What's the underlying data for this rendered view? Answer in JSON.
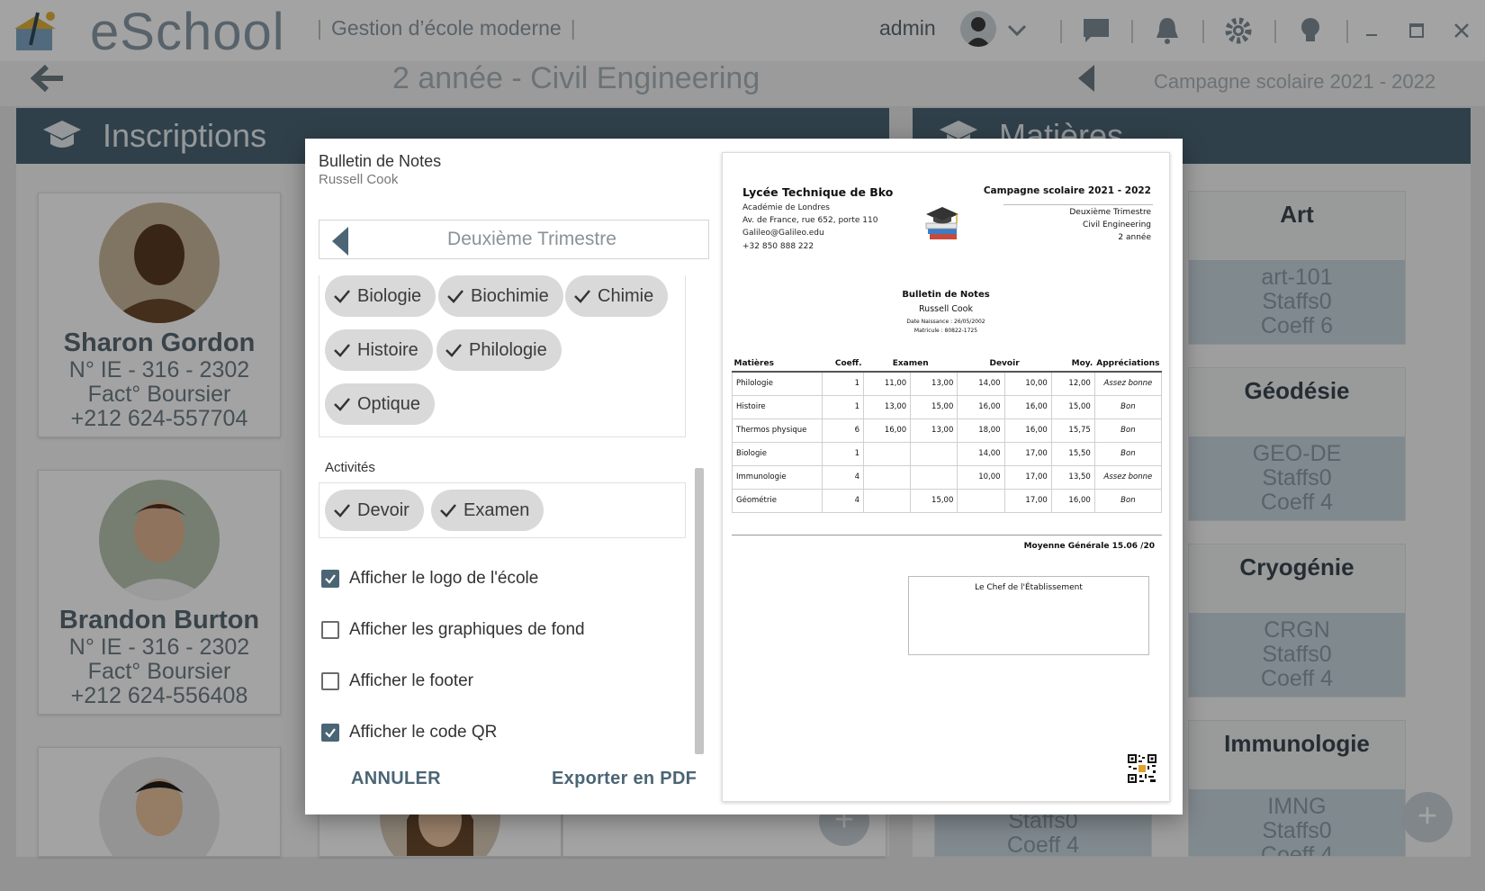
{
  "app": {
    "name": "eSchool",
    "tagline": "Gestion d’école moderne",
    "user": "admin"
  },
  "context": {
    "class_title": "2  année - Civil Engineering",
    "campaign": "Campagne scolaire 2021 - 2022"
  },
  "panels": {
    "left_title": "Inscriptions",
    "right_title": "Matières"
  },
  "students": [
    {
      "name": "Sharon Gordon",
      "id": "N° IE - 316 - 2302",
      "fact": "Fact° Boursier",
      "phone": "+212 624-557704"
    },
    {
      "name": "Brandon Burton",
      "id": "N° IE - 316 - 2302",
      "fact": "Fact° Boursier",
      "phone": "+212 624-556408"
    }
  ],
  "subjects": [
    {
      "name": "Art",
      "code": "art-101",
      "staff": "Staffs0",
      "coeff": "Coeff 6"
    },
    {
      "name": "Géodésie",
      "code": "GEO-DE",
      "staff": "Staffs0",
      "coeff": "Coeff 4"
    },
    {
      "name": "Cryogénie",
      "code": "CRGN",
      "staff": "Staffs0",
      "coeff": "Coeff 4"
    },
    {
      "name": "Immunologie",
      "code": "IMNG",
      "staff": "Staffs0",
      "coeff": "Coeff 4"
    }
  ],
  "hidden_card": {
    "staff": "Staffs0",
    "coeff": "Coeff 4"
  },
  "modal": {
    "title": "Bulletin de Notes",
    "student": "Russell Cook",
    "term": "Deuxième Trimestre",
    "subject_chips": [
      "Biologie",
      "Biochimie",
      "Chimie",
      "Histoire",
      "Philologie",
      "Optique"
    ],
    "activities_label": "Activités",
    "activity_chips": [
      "Devoir",
      "Examen"
    ],
    "options": [
      {
        "label": "Afficher le logo de l'école",
        "checked": true
      },
      {
        "label": "Afficher les graphiques de fond",
        "checked": false
      },
      {
        "label": "Afficher le footer",
        "checked": false
      },
      {
        "label": "Afficher le code QR",
        "checked": true
      }
    ],
    "cancel": "ANNULER",
    "export": "Exporter en PDF"
  },
  "report": {
    "school": "Lycée Technique de Bko",
    "academy": "Académie de Londres",
    "address": "Av. de France, rue 652, porte 110",
    "email": "Galileo@Galileo.edu",
    "phone": "+32 850 888 222",
    "campaign": "Campagne scolaire 2021 - 2022",
    "term": "Deuxième Trimestre",
    "program": "Civil Engineering",
    "level": "2 année",
    "doc_title": "Bulletin de Notes",
    "student": "Russell Cook",
    "birth": "Date Naissance : 26/05/2002",
    "matricule": "Matricule : 80822-1725",
    "headers": [
      "Matières",
      "Coeff.",
      "Examen",
      "Devoir",
      "Moy.",
      "Appréciations"
    ],
    "rows": [
      [
        "Philologie",
        "1",
        "11,00",
        "13,00",
        "14,00",
        "10,00",
        "12,00",
        "Assez bonne"
      ],
      [
        "Histoire",
        "1",
        "13,00",
        "15,00",
        "16,00",
        "16,00",
        "15,00",
        "Bon"
      ],
      [
        "Thermos physique",
        "6",
        "16,00",
        "13,00",
        "18,00",
        "16,00",
        "15,75",
        "Bon"
      ],
      [
        "Biologie",
        "1",
        "",
        "",
        "14,00",
        "17,00",
        "15,50",
        "Bon"
      ],
      [
        "Immunologie",
        "4",
        "",
        "",
        "10,00",
        "17,00",
        "13,50",
        "Assez bonne"
      ],
      [
        "Géométrie",
        "4",
        "",
        "15,00",
        "",
        "17,00",
        "16,00",
        "Bon"
      ]
    ],
    "average": "Moyenne Générale 15.06 /20",
    "signature": "Le Chef de l'Établissement"
  },
  "colors": {
    "primary": "#4b6575",
    "chip": "#d9d9d9",
    "overlay": "rgba(0,0,0,0.36)"
  }
}
